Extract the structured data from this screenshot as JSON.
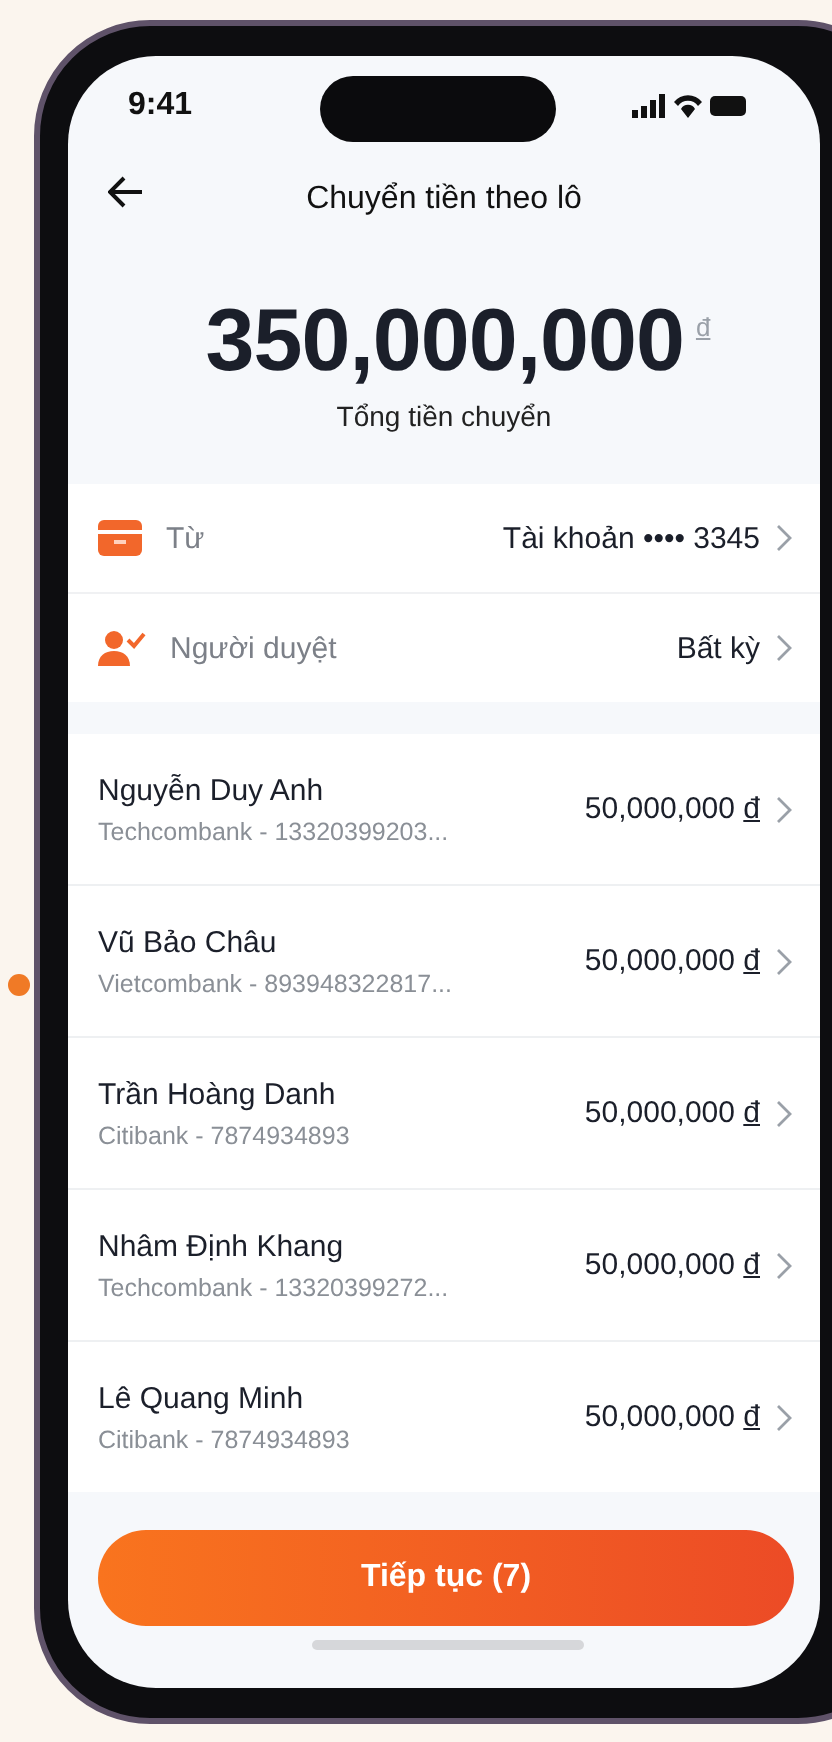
{
  "status_bar": {
    "time": "9:41"
  },
  "header": {
    "title": "Chuyển tiền theo lô"
  },
  "total": {
    "amount": "350,000,000",
    "currency": "đ",
    "label": "Tổng tiền chuyển"
  },
  "settings": [
    {
      "kind": "account",
      "label": "Từ",
      "value": "Tài khoản •••• 3345"
    },
    {
      "kind": "approver",
      "label": "Người duyệt",
      "value": "Bất kỳ"
    }
  ],
  "recipients": [
    {
      "name": "Nguyễn Duy Anh",
      "account": "Techcombank - 13320399203...",
      "amount": "50,000,000",
      "currency": "đ"
    },
    {
      "name": "Vũ Bảo Châu",
      "account": "Vietcombank - 893948322817...",
      "amount": "50,000,000",
      "currency": "đ"
    },
    {
      "name": "Trần Hoàng Danh",
      "account": "Citibank - 7874934893",
      "amount": "50,000,000",
      "currency": "đ"
    },
    {
      "name": "Nhâm Định Khang",
      "account": "Techcombank - 13320399272...",
      "amount": "50,000,000",
      "currency": "đ"
    },
    {
      "name": "Lê Quang Minh",
      "account": "Citibank - 7874934893",
      "amount": "50,000,000",
      "currency": "đ"
    }
  ],
  "continue_button": {
    "label": "Tiếp tục (7)"
  }
}
